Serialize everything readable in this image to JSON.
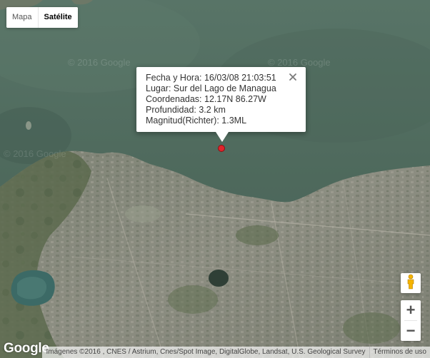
{
  "map_type": {
    "options": [
      "Mapa",
      "Satélite"
    ],
    "active": "Satélite"
  },
  "info_window": {
    "lines": [
      "Fecha y Hora: 16/03/08 21:03:51",
      "Lugar: Sur del Lago de Managua",
      "Coordenadas: 12.17N 86.27W",
      "Profundidad: 3.2 km",
      "Magnitud(Richter): 1.3ML"
    ]
  },
  "zoom": {
    "in_label": "+",
    "out_label": "−"
  },
  "footer": {
    "logo": "Google",
    "attribution": "Imágenes ©2016 , CNES / Astrium, Cnes/Spot Image, DigitalGlobe, Landsat, U.S. Geological Survey",
    "terms": "Términos de uso"
  },
  "watermark": "© 2016 Google",
  "colors": {
    "lake": "#4f6a5e",
    "city": "#8a8a7e",
    "marker": "#e0242b"
  },
  "icons": [
    "close-icon",
    "pegman-icon",
    "zoom-in-icon",
    "zoom-out-icon"
  ]
}
